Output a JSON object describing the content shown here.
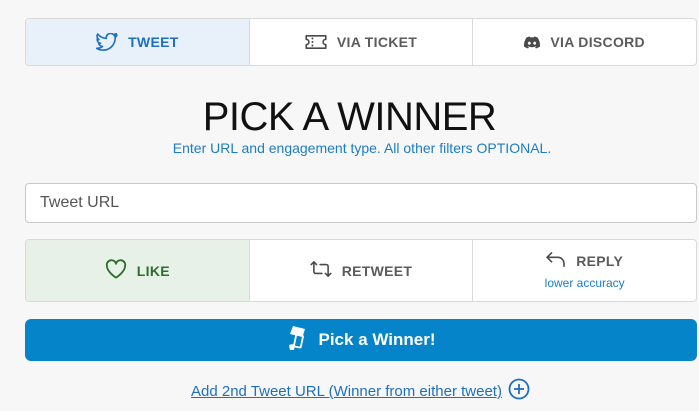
{
  "tabs": [
    {
      "label": "TWEET",
      "icon": "twitter-bird-icon",
      "active": true
    },
    {
      "label": "VIA TICKET",
      "icon": "ticket-icon",
      "active": false
    },
    {
      "label": "VIA DISCORD",
      "icon": "discord-icon",
      "active": false
    }
  ],
  "main": {
    "title": "PICK A WINNER",
    "subtitle": "Enter URL and engagement type. All other filters OPTIONAL."
  },
  "url_input": {
    "placeholder": "Tweet URL",
    "value": ""
  },
  "engagement": [
    {
      "label": "LIKE",
      "icon": "heart-icon",
      "active": true,
      "note": ""
    },
    {
      "label": "RETWEET",
      "icon": "retweet-icon",
      "active": false,
      "note": ""
    },
    {
      "label": "REPLY",
      "icon": "reply-icon",
      "active": false,
      "note": "lower accuracy"
    }
  ],
  "pick_button": {
    "label": "Pick a Winner!",
    "icon": "ticket-hand-icon"
  },
  "add_link": {
    "label": "Add 2nd Tweet URL (Winner from either tweet)",
    "icon": "plus-circle-icon"
  },
  "colors": {
    "accent_blue": "#1d6fc2",
    "button_blue": "#0584c9",
    "active_tab_bg": "#e8f0f9",
    "active_option_bg": "#e8f1e8",
    "active_option_text": "#2c6e2c"
  }
}
